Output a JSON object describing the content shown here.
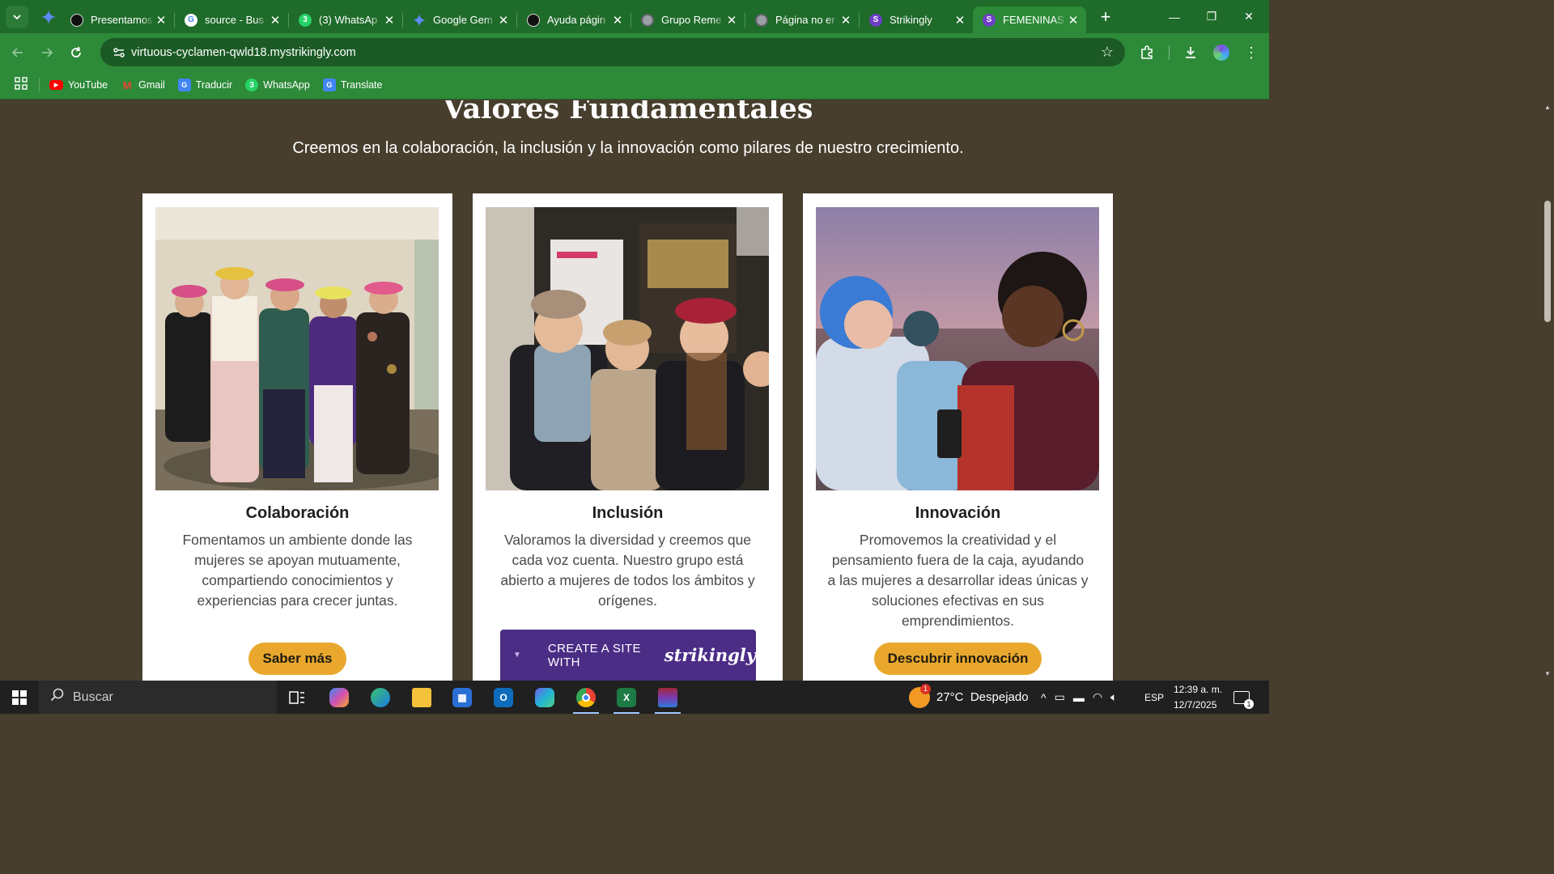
{
  "browser": {
    "tabs": [
      {
        "title": "Presentamos",
        "favicon": "openai-icon",
        "color": "#111111"
      },
      {
        "title": "source - Bus",
        "favicon": "google-icon",
        "color": "#ffffff"
      },
      {
        "title": "(3) WhatsAp",
        "favicon": "whatsapp-icon",
        "color": "#25d366"
      },
      {
        "title": "Google Gem",
        "favicon": "gemini-icon",
        "color": "#4f7ef2"
      },
      {
        "title": "Ayuda págin",
        "favicon": "openai-icon",
        "color": "#111111"
      },
      {
        "title": "Grupo Reme",
        "favicon": "globe-icon",
        "color": "#5f6368"
      },
      {
        "title": "Página no er",
        "favicon": "globe-icon",
        "color": "#5f6368"
      },
      {
        "title": "Strikingly",
        "favicon": "strikingly-icon",
        "color": "#6c3fc5"
      },
      {
        "title": "FEMENINAS",
        "favicon": "strikingly-icon",
        "color": "#6c3fc5"
      }
    ],
    "active_tab_index": 8,
    "url": "virtuous-cyclamen-qwld18.mystrikingly.com",
    "bookmarks": [
      {
        "label": "YouTube",
        "icon": "youtube-icon",
        "color": "#ff0000"
      },
      {
        "label": "Gmail",
        "icon": "gmail-icon",
        "color": "#ea4335"
      },
      {
        "label": "Traducir",
        "icon": "translate-icon",
        "color": "#4285f4"
      },
      {
        "label": "WhatsApp",
        "icon": "whatsapp-icon",
        "color": "#25d366"
      },
      {
        "label": "Translate",
        "icon": "translate-icon",
        "color": "#4285f4"
      }
    ],
    "theme_color": "#2d8a38"
  },
  "page": {
    "section_title": "Valores Fundamentales",
    "section_subtitle": "Creemos en la colaboración, la inclusión y la innovación como pilares de nuestro crecimiento.",
    "background": "#473e2e",
    "accent": "#e9a82d",
    "cards": [
      {
        "title": "Colaboración",
        "text": "Fomentamos un ambiente donde las mujeres se apoyan mutuamente, compartiendo conocimientos y experiencias para crecer juntas.",
        "button": "Saber más"
      },
      {
        "title": "Inclusión",
        "text": "Valoramos la diversidad y creemos que cada voz cuenta. Nuestro grupo está abierto a mujeres de todos los ámbitos y orígenes."
      },
      {
        "title": "Innovación",
        "text": "Promovemos la creatividad y el pensamiento fuera de la caja, ayudando a las mujeres a desarrollar ideas únicas y soluciones efectivas en sus emprendimientos.",
        "button": "Descubrir innovación"
      }
    ],
    "badge": {
      "text": "CREATE A SITE WITH",
      "brand": "strikingly"
    }
  },
  "taskbar": {
    "search_placeholder": "Buscar",
    "weather": "27°C  Despejado",
    "weather_badge": "1",
    "language": "ESP",
    "time": "12:39 a. m.",
    "date": "12/7/2025",
    "notification_count": "1"
  }
}
